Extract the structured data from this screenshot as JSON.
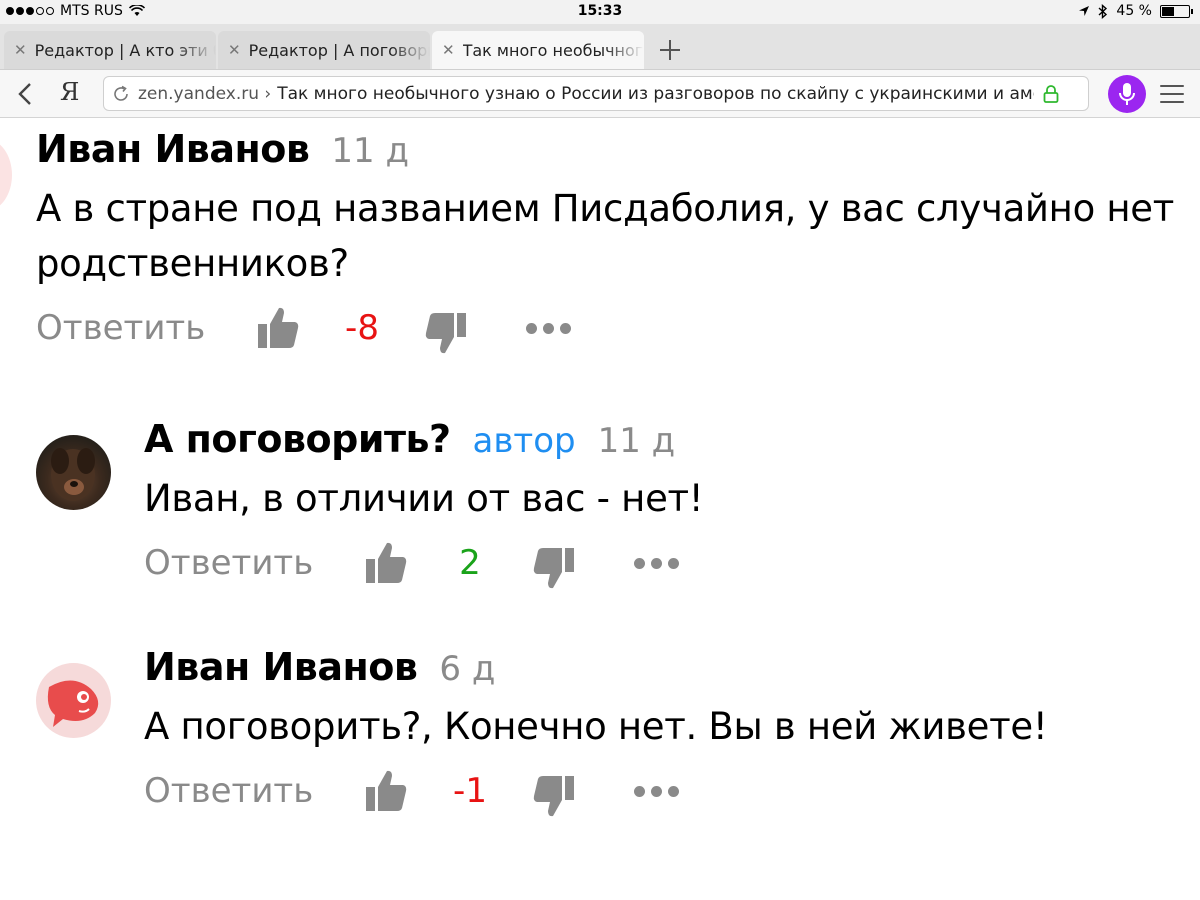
{
  "status_bar": {
    "carrier": "MTS RUS",
    "time": "15:33",
    "battery": "45 %",
    "battery_level": 0.45,
    "signal_bars": 3
  },
  "tabs": [
    {
      "label": "Редактор | А кто эти б",
      "active": false
    },
    {
      "label": "Редактор | А поговори",
      "active": false
    },
    {
      "label": "Так много необычного",
      "active": true
    }
  ],
  "address_bar": {
    "domain": "zen.yandex.ru ›",
    "title": "Так много необычного узнаю о России из разговоров по скайпу с украинскими и аме",
    "home_glyph": "Я",
    "mic_color": "#9b26f0",
    "lock_color": "#2eb82e"
  },
  "comments": [
    {
      "author": "Иван Иванов",
      "badge": "",
      "age": "11 д",
      "text": "А в стране под названием Писдаболия, у вас случайно нет родственников?",
      "reply_label": "Ответить",
      "score": "-8"
    },
    {
      "author": "А поговорить?",
      "badge": "автор",
      "age": "11 д",
      "text": "Иван, в отличии от вас - нет!",
      "reply_label": "Ответить",
      "score": "2"
    },
    {
      "author": "Иван Иванов",
      "badge": "",
      "age": "6 д",
      "text": "А поговорить?, Конечно нет. Вы в ней живете!",
      "reply_label": "Ответить",
      "score": "-1"
    }
  ],
  "colors": {
    "negative_score": "#e81313",
    "positive_score": "#1aa31a",
    "author_badge": "#1f8ef1",
    "muted": "#8a8a8a"
  }
}
